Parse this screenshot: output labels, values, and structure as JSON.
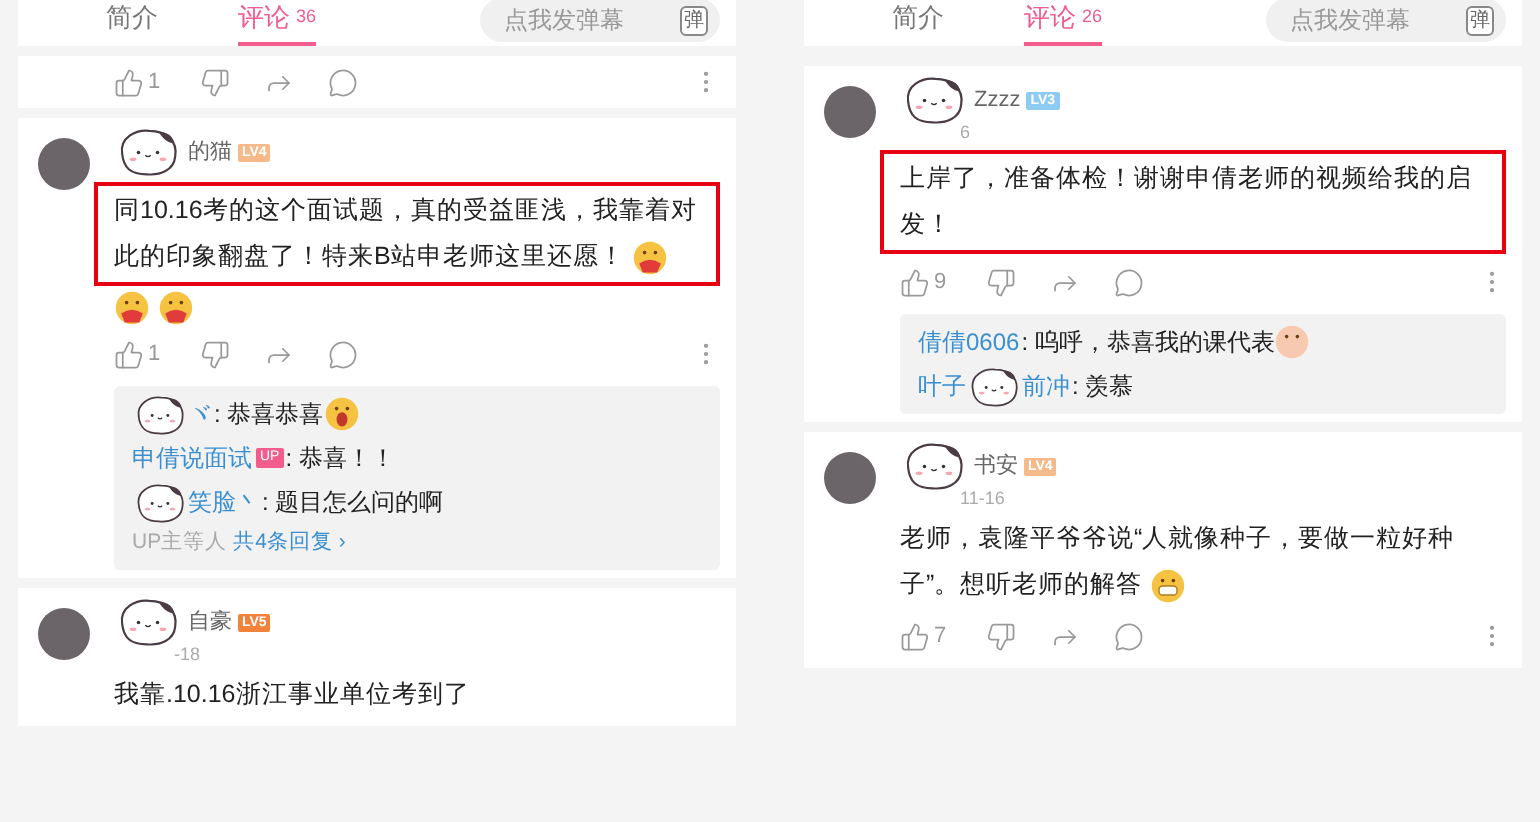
{
  "panels": [
    {
      "tabs": [
        {
          "label": "简介",
          "selected": false
        },
        {
          "label": "评论",
          "count": "36",
          "selected": true
        }
      ],
      "danmaku": {
        "placeholder": "点我发弹幕",
        "button": "弹"
      },
      "items": [
        {
          "kind": "actions",
          "likes": "1"
        },
        {
          "kind": "comment",
          "sticker": true,
          "name": "的猫",
          "badge": {
            "label": "LV4",
            "color": "#f6b98a"
          },
          "text": "同10.16考的这个面试题，真的受益匪浅，我靠着对此的印象翻盘了！特来B站申老师这里还愿！",
          "boxed": true,
          "trailing_emoji": {
            "kind": "hug"
          },
          "emoji_row": [
            {
              "kind": "hug"
            },
            {
              "kind": "hug"
            }
          ],
          "likes": "1",
          "replies": {
            "lines": [
              {
                "name_parts": [
                  "ヾ"
                ],
                "sticker": true,
                "up": false,
                "text": ": 恭喜恭喜",
                "emoji": {
                  "kind": "shock"
                }
              },
              {
                "name_parts": [
                  "申倩说面试"
                ],
                "sticker": false,
                "up": true,
                "up_label": "UP",
                "text": ": 恭喜！！"
              },
              {
                "name_parts": [
                  "笑脸丶"
                ],
                "sticker": true,
                "up": false,
                "text": ": 题目怎么问的啊"
              }
            ],
            "footer_prefix": "UP主等人",
            "footer_link": "共4条回复 ›"
          }
        },
        {
          "kind": "comment",
          "sticker": true,
          "name": "自豪",
          "badge": {
            "label": "LV5",
            "color": "#f0823a"
          },
          "date": "-18",
          "text": "我靠.10.16浙江事业单位考到了",
          "boxed": false
        }
      ]
    },
    {
      "tabs": [
        {
          "label": "简介",
          "selected": false
        },
        {
          "label": "评论",
          "count": "26",
          "selected": true
        }
      ],
      "danmaku": {
        "placeholder": "点我发弹幕",
        "button": "弹"
      },
      "items": [
        {
          "kind": "comment",
          "sticker": true,
          "name": "Zzzz",
          "badge": {
            "label": "LV3",
            "color": "#8ecbf2"
          },
          "date": "6",
          "text": "上岸了，准备体检！谢谢申倩老师的视频给我的启发！",
          "boxed": true,
          "likes": "9",
          "replies": {
            "lines": [
              {
                "name_parts": [
                  "倩倩0606"
                ],
                "sticker": false,
                "up": false,
                "text": ": 呜呼，恭喜我的课代表",
                "emoji": {
                  "kind": "hand"
                }
              },
              {
                "name_parts": [
                  "叶子",
                  "前冲"
                ],
                "sticker": true,
                "up": false,
                "text": ": 羡慕"
              }
            ]
          }
        },
        {
          "kind": "comment",
          "sticker": true,
          "name": "书安",
          "badge": {
            "label": "LV4",
            "color": "#f6b98a"
          },
          "date": "11-16",
          "text": "老师，袁隆平爷爷说“人就像种子，要做一粒好种子”。想听老师的解答",
          "boxed": false,
          "trailing_emoji": {
            "kind": "grin"
          },
          "likes": "7"
        }
      ]
    }
  ]
}
